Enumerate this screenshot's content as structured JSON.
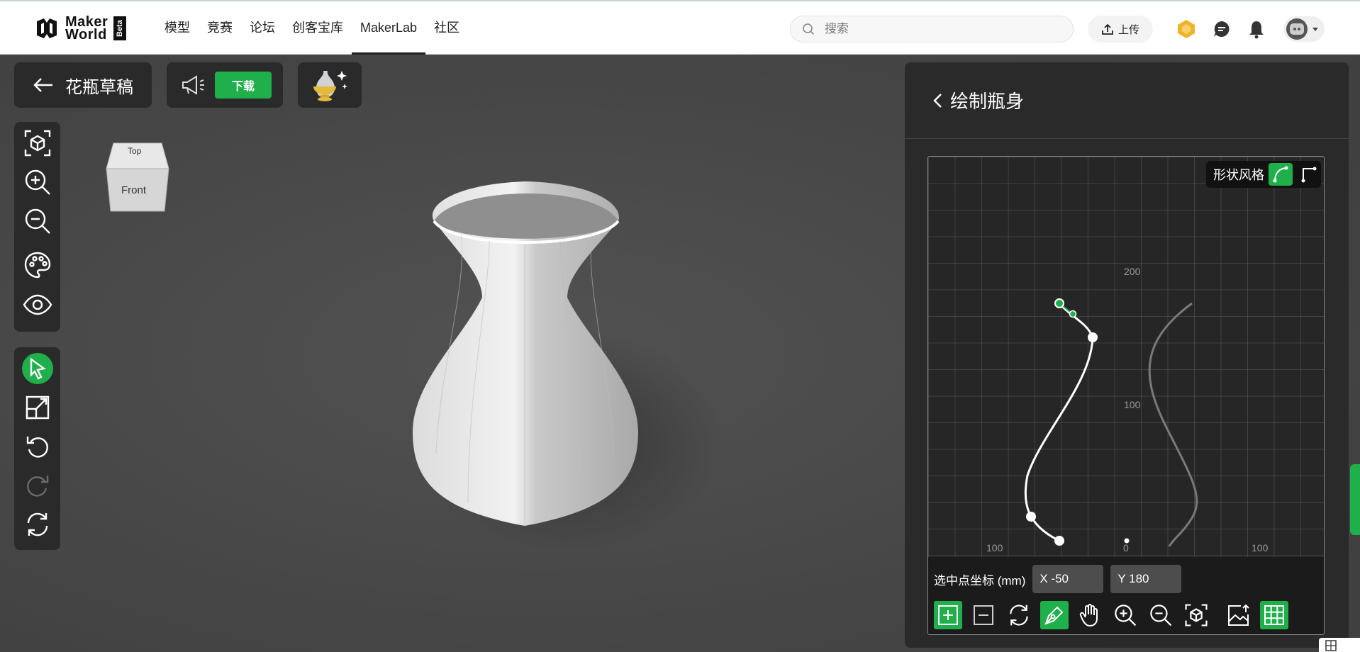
{
  "header": {
    "logo": {
      "line1": "Maker",
      "line2": "World",
      "badge": "Beta"
    },
    "nav": [
      {
        "label": "模型",
        "active": false
      },
      {
        "label": "竞赛",
        "active": false
      },
      {
        "label": "论坛",
        "active": false
      },
      {
        "label": "创客宝库",
        "active": false
      },
      {
        "label": "MakerLab",
        "active": true
      },
      {
        "label": "社区",
        "active": false
      }
    ],
    "search": {
      "placeholder": "搜索"
    },
    "upload_label": "上传",
    "icons": [
      "coin-icon",
      "message-icon",
      "bell-icon",
      "avatar"
    ]
  },
  "project": {
    "title": "花瓶草稿",
    "download_label": "下载"
  },
  "viewcube": {
    "top": "Top",
    "front": "Front"
  },
  "left_tools": {
    "group1": [
      "fit-view-icon",
      "zoom-in-icon",
      "zoom-out-icon",
      "palette-icon",
      "eye-icon"
    ],
    "group2": [
      "select-cursor-icon",
      "scale-icon",
      "undo-icon",
      "redo-icon",
      "refresh-icon"
    ]
  },
  "sidebar": {
    "title": "绘制瓶身",
    "shape_style_label": "形状风格",
    "axis": {
      "y_labels": [
        "200",
        "100"
      ],
      "x_labels": [
        "100",
        "0",
        "100"
      ]
    },
    "selected_point": {
      "label": "选中点坐标 (mm)",
      "x": "X -50",
      "y": "Y 180"
    },
    "tools": [
      "add-point-icon",
      "remove-point-icon",
      "refresh-icon",
      "pen-icon",
      "hand-icon",
      "zoom-in-icon",
      "zoom-out-icon",
      "fit-view-icon",
      "image-upload-icon",
      "grid-icon"
    ]
  },
  "colors": {
    "accent": "#1fb04b",
    "panel": "#2a2a2a",
    "canvas": "#4a4a4a"
  }
}
